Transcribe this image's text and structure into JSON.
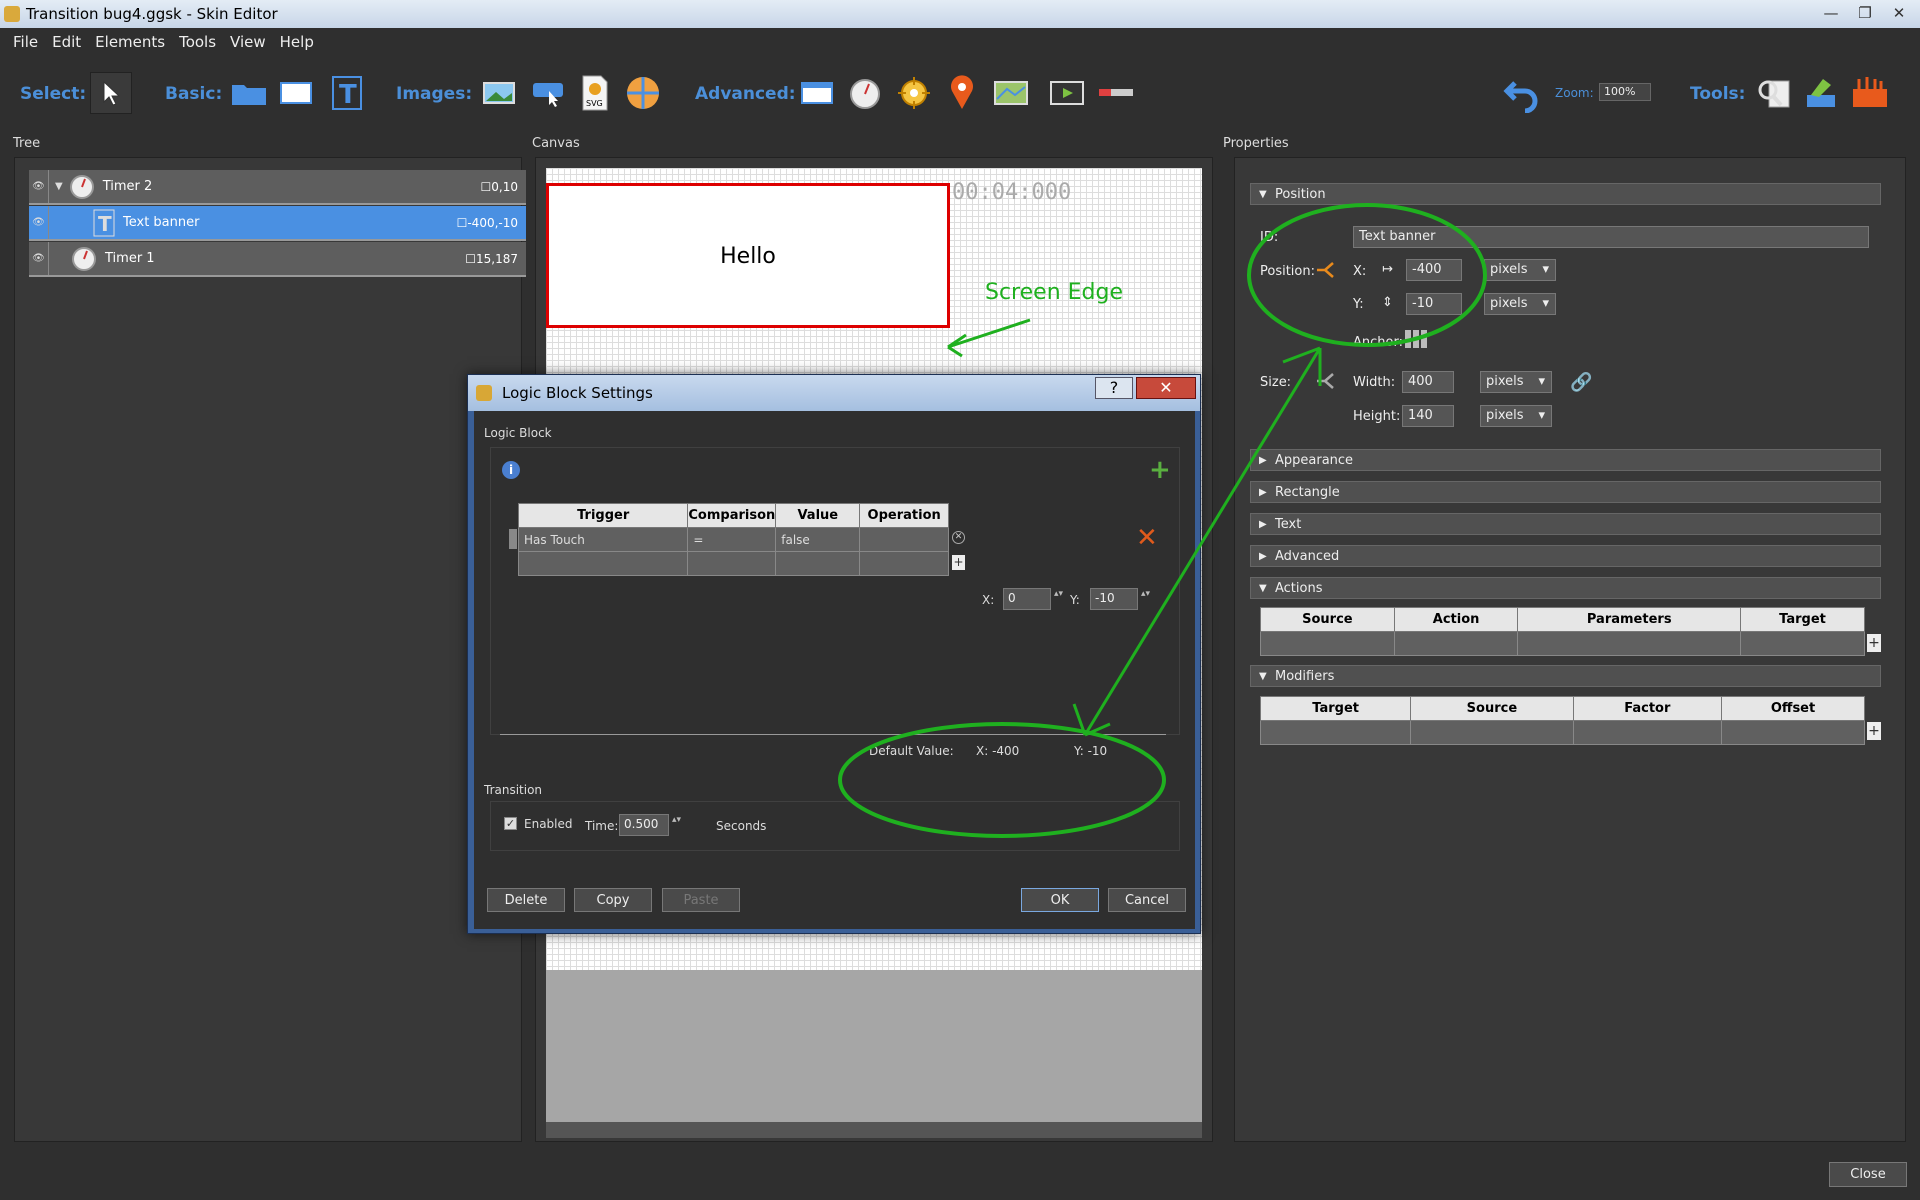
{
  "window": {
    "title": "Transition bug4.ggsk - Skin Editor",
    "min": "—",
    "max": "❐",
    "close": "✕"
  },
  "menu": [
    "File",
    "Edit",
    "Elements",
    "Tools",
    "View",
    "Help"
  ],
  "toolbar": {
    "select": "Select:",
    "basic": "Basic:",
    "images": "Images:",
    "advanced": "Advanced:",
    "zoom_label": "Zoom:",
    "zoom_value": "100%",
    "tools": "Tools:",
    "svg_badge": "SVG"
  },
  "panels": {
    "tree": "Tree",
    "canvas": "Canvas",
    "properties": "Properties"
  },
  "tree": [
    {
      "name": "Timer 2",
      "coord": "☐0,10"
    },
    {
      "name": "Text banner",
      "coord": "☐-400,-10"
    },
    {
      "name": "Timer 1",
      "coord": "☐15,187"
    }
  ],
  "canvas": {
    "banner_text": "Hello",
    "timer_text": "00:04:000",
    "annotation": "Screen Edge"
  },
  "props": {
    "position_header": "Position",
    "id_label": "ID:",
    "id_value": "Text banner",
    "position_label": "Position:",
    "x_label": "X:",
    "x_value": "-400",
    "x_unit": "pixels",
    "y_label": "Y:",
    "y_value": "-10",
    "y_unit": "pixels",
    "anchor_label": "Anchor:",
    "size_label": "Size:",
    "width_label": "Width:",
    "width_value": "400",
    "width_unit": "pixels",
    "height_label": "Height:",
    "height_value": "140",
    "height_unit": "pixels",
    "sections": [
      "Appearance",
      "Rectangle",
      "Text",
      "Advanced"
    ],
    "actions_header": "Actions",
    "actions_cols": [
      "Source",
      "Action",
      "Parameters",
      "Target"
    ],
    "modifiers_header": "Modifiers",
    "modifiers_cols": [
      "Target",
      "Source",
      "Factor",
      "Offset"
    ]
  },
  "dialog": {
    "title": "Logic Block Settings",
    "help": "?",
    "close": "✕",
    "group_label": "Logic Block",
    "cols": [
      "Trigger",
      "Comparison",
      "Value",
      "Operation"
    ],
    "row": {
      "trigger": "Has Touch",
      "comparison": "=",
      "value": "false",
      "operation": ""
    },
    "x_label": "X:",
    "x_value": "0",
    "y_label": "Y:",
    "y_value": "-10",
    "default_label": "Default Value:",
    "default_x": "X:  -400",
    "default_y": "Y:  -10",
    "transition_label": "Transition",
    "enabled_label": "Enabled",
    "time_label": "Time:",
    "time_value": "0.500",
    "seconds_label": "Seconds",
    "delete": "Delete",
    "copy": "Copy",
    "paste": "Paste",
    "ok": "OK",
    "cancel": "Cancel"
  },
  "close_button": "Close",
  "colors": {
    "accent": "#4a90e2",
    "annotation": "#1fb01f",
    "delete": "#e05a1c"
  }
}
